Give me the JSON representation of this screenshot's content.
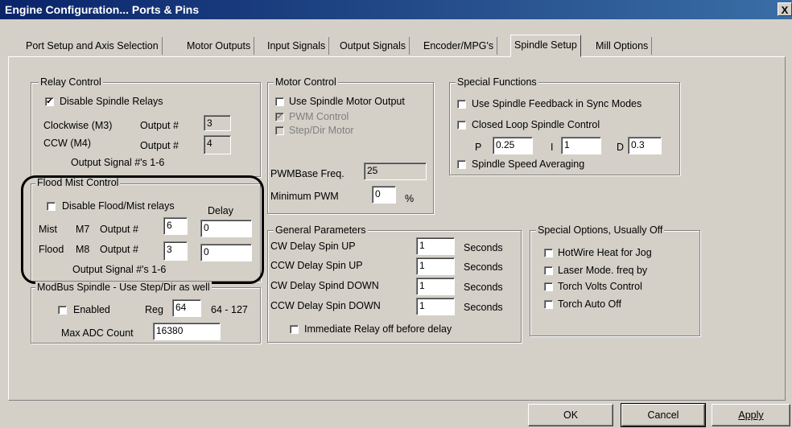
{
  "window": {
    "title": "Engine Configuration... Ports & Pins",
    "close_glyph": "X"
  },
  "tabs": [
    {
      "label": "Port Setup and Axis Selection"
    },
    {
      "label": "Motor Outputs"
    },
    {
      "label": "Input Signals"
    },
    {
      "label": "Output Signals"
    },
    {
      "label": "Encoder/MPG's"
    },
    {
      "label": "Spindle Setup",
      "active": true
    },
    {
      "label": "Mill Options"
    }
  ],
  "relay_control": {
    "title": "Relay Control",
    "disable_label": "Disable Spindle Relays",
    "disable_checked": true,
    "cw_label": "Clockwise (M3)",
    "cw_output_label": "Output #",
    "cw_value": "3",
    "ccw_label": "CCW (M4)",
    "ccw_output_label": "Output #",
    "ccw_value": "4",
    "signal_note": "Output Signal #'s 1-6"
  },
  "flood_mist": {
    "title": "Flood Mist Control",
    "disable_label": "Disable Flood/Mist relays",
    "disable_checked": false,
    "delay_label": "Delay",
    "mist_label": "Mist",
    "mist_code": "M7",
    "mist_output_label": "Output #",
    "mist_output": "6",
    "mist_delay": "0",
    "flood_label": "Flood",
    "flood_code": "M8",
    "flood_output_label": "Output #",
    "flood_output": "3",
    "flood_delay": "0",
    "signal_note": "Output Signal #'s 1-6"
  },
  "modbus": {
    "title": "ModBus Spindle - Use Step/Dir as well",
    "enabled_label": "Enabled",
    "enabled_checked": false,
    "reg_label": "Reg",
    "reg_value": "64",
    "reg_range": "64 - 127",
    "max_adc_label": "Max ADC Count",
    "max_adc_value": "16380"
  },
  "motor_control": {
    "title": "Motor Control",
    "use_motor_label": "Use Spindle Motor Output",
    "use_motor_checked": false,
    "pwm_label": "PWM Control",
    "pwm_checked": true,
    "stepdir_label": "Step/Dir Motor",
    "stepdir_checked": false,
    "pwmbase_label": "PWMBase Freq.",
    "pwmbase_value": "25",
    "min_pwm_label": "Minimum PWM",
    "min_pwm_value": "0",
    "min_pwm_unit": "%"
  },
  "special_functions": {
    "title": "Special Functions",
    "feedback_label": "Use Spindle Feedback in Sync Modes",
    "feedback_checked": false,
    "closed_loop_label": "Closed Loop Spindle Control",
    "closed_loop_checked": false,
    "p_label": "P",
    "p_value": "0.25",
    "i_label": "I",
    "i_value": "1",
    "d_label": "D",
    "d_value": "0.3",
    "averaging_label": "Spindle Speed Averaging",
    "averaging_checked": false
  },
  "general": {
    "title": "General Parameters",
    "rows": [
      {
        "label": "CW Delay Spin UP",
        "value": "1",
        "unit": "Seconds"
      },
      {
        "label": "CCW Delay Spin UP",
        "value": "1",
        "unit": "Seconds"
      },
      {
        "label": "CW Delay Spind DOWN",
        "value": "1",
        "unit": "Seconds"
      },
      {
        "label": "CCW Delay Spin DOWN",
        "value": "1",
        "unit": "Seconds"
      }
    ],
    "immediate_label": "Immediate Relay off before delay",
    "immediate_checked": false
  },
  "special_options": {
    "title": "Special Options, Usually Off",
    "items": [
      {
        "label": "HotWire Heat for Jog",
        "checked": false
      },
      {
        "label": "Laser Mode. freq by",
        "checked": false
      },
      {
        "label": "Torch Volts Control",
        "checked": false
      },
      {
        "label": "Torch Auto Off",
        "checked": false
      }
    ]
  },
  "buttons": {
    "ok": "OK",
    "cancel": "Cancel",
    "apply": "Apply"
  },
  "colors": {
    "face": "#d4d0c8",
    "title_start": "#0a246a",
    "title_end": "#3a6ea5",
    "annotation": "#000000"
  }
}
